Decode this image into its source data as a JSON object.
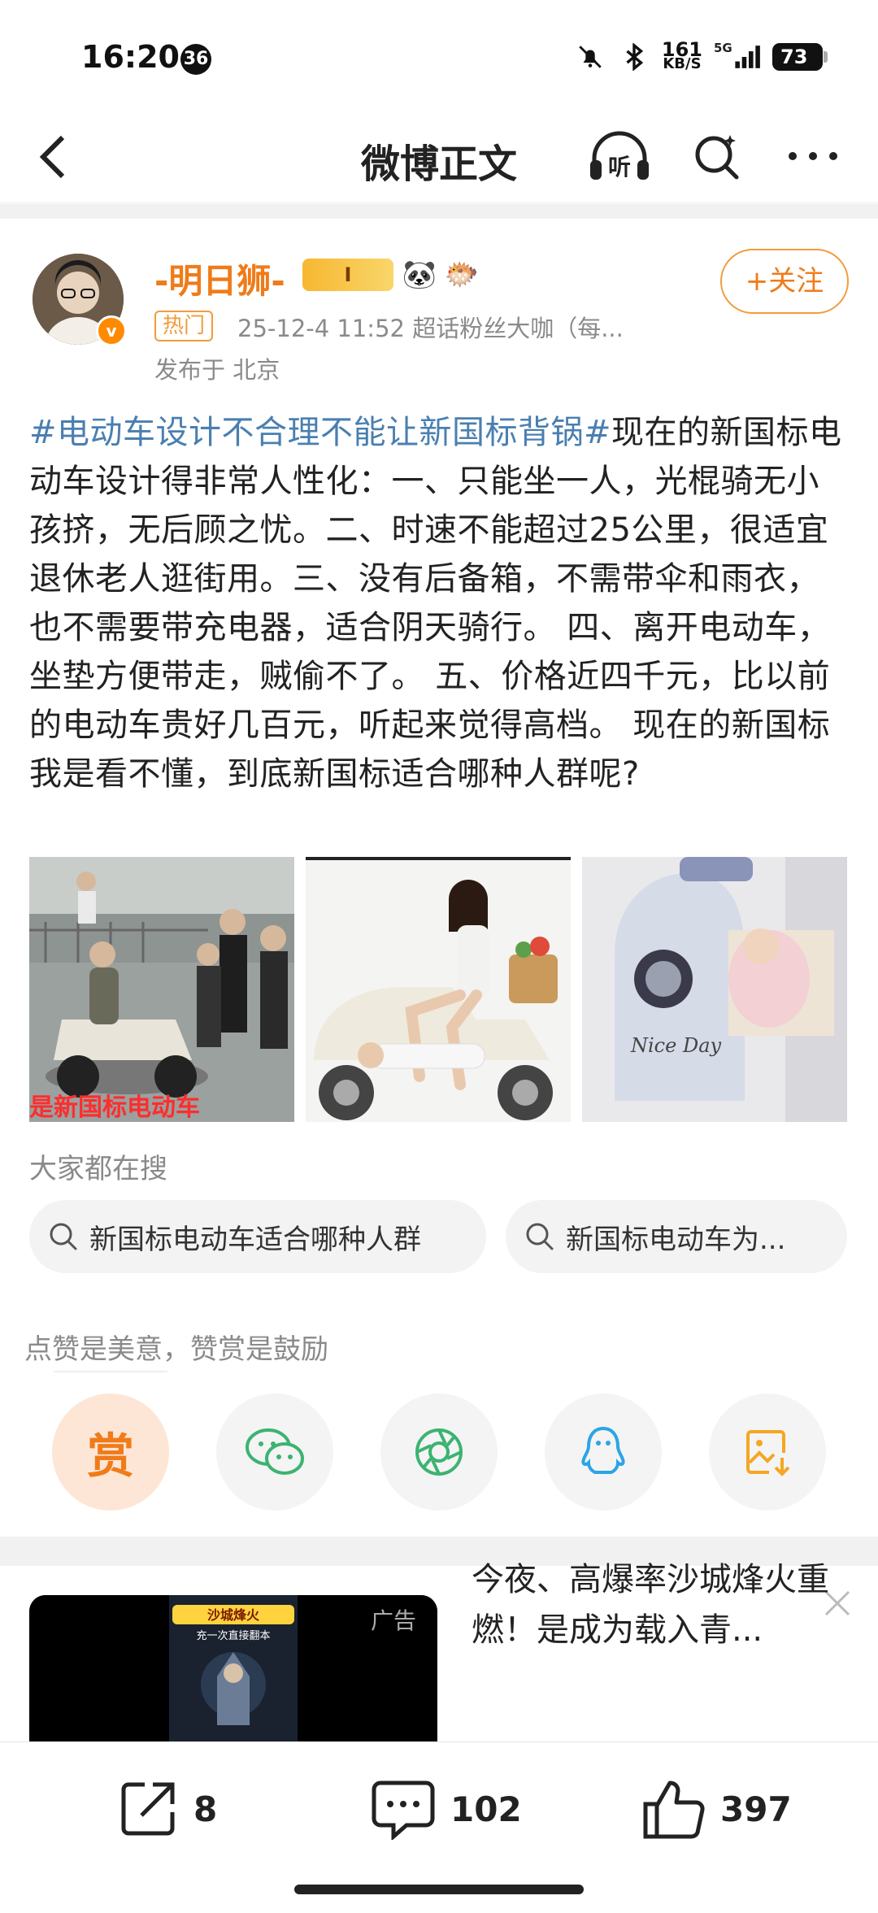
{
  "status_bar": {
    "time": "16:20",
    "notification_count": "36",
    "net_speed": "161",
    "net_speed_unit": "KB/S",
    "network": "5G",
    "battery": "73"
  },
  "nav": {
    "title": "微博正文",
    "listen_label": "听"
  },
  "author": {
    "name": "-明日狮-",
    "vip_label": "I",
    "emoji_1": "🐼",
    "emoji_2": "🐡",
    "hot_tag": "热门",
    "meta": "25-12-4 11:52  超话粉丝大咖（每...",
    "location": "发布于 北京",
    "follow_label": "+关注"
  },
  "post": {
    "hashtag": "#电动车设计不合理不能让新国标背锅#",
    "body": "现在的新国标电动车设计得非常人性化：一、只能坐一人，光棍骑无小孩挤，无后顾之忧。二、时速不能超过25公里，很适宜退休老人逛街用。三、没有后备箱，不需带伞和雨衣，也不需要带充电器，适合阴天骑行。 四、离开电动车，坐垫方便带走，贼偷不了。 五、价格近四千元，比以前的电动车贵好几百元，听起来觉得高档。 现在的新国标我是看不懂，到底新国标适合哪种人群呢?",
    "image_1_caption": "是新国标电动车",
    "image_3_caption": "Nice Day"
  },
  "search_section": {
    "title": "大家都在搜",
    "chips": [
      {
        "label": "新国标电动车适合哪种人群"
      },
      {
        "label": "新国标电动车为..."
      }
    ]
  },
  "reward": {
    "hint": "点赞是美意，赞赏是鼓励",
    "reward_label": "赏"
  },
  "ad": {
    "label": "广告",
    "text": "今夜、高爆率沙城烽火重燃！是成为载入青...",
    "poster_title": "沙城烽火",
    "poster_sub": "充一次直接翻本"
  },
  "bottom": {
    "share_count": "8",
    "comment_count": "102",
    "like_count": "397"
  },
  "colors": {
    "accent_orange": "#f07b1a",
    "hashtag_blue": "#4a7fb0",
    "meta_gray": "#8a8a8a"
  }
}
